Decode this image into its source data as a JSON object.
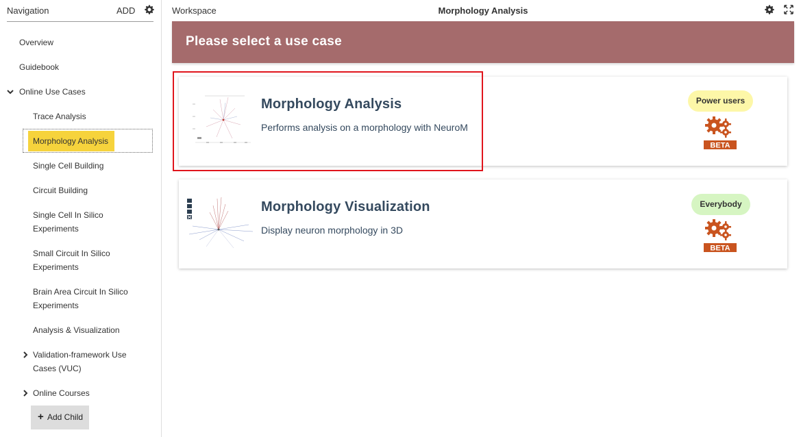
{
  "sidebar": {
    "title": "Navigation",
    "add_label": "ADD",
    "items": [
      {
        "label": "Overview"
      },
      {
        "label": "Guidebook"
      },
      {
        "label": "Online Use Cases"
      },
      {
        "label": "Trace Analysis"
      },
      {
        "label": "Morphology Analysis"
      },
      {
        "label": "Single Cell Building"
      },
      {
        "label": "Circuit Building"
      },
      {
        "label": "Single Cell In Silico",
        "label2": "Experiments"
      },
      {
        "label": "Small Circuit In Silico",
        "label2": "Experiments"
      },
      {
        "label": "Brain Area Circuit In Silico",
        "label2": "Experiments"
      },
      {
        "label": "Analysis & Visualization"
      },
      {
        "label": "Validation-framework Use",
        "label2": "Cases (VUC)"
      },
      {
        "label": "Online Courses"
      }
    ],
    "selected": "Morphology Analysis",
    "add_child_label": "Add Child"
  },
  "header": {
    "workspace_label": "Workspace",
    "page_title": "Morphology Analysis"
  },
  "banner": {
    "text": "Please select a use case"
  },
  "cards": [
    {
      "title": "Morphology Analysis",
      "description": "Performs analysis on a morphology with NeuroM",
      "badge": "Power users",
      "badge_color": "#fdf7a8",
      "tag": "BETA"
    },
    {
      "title": "Morphology Visualization",
      "description": "Display neuron morphology in 3D",
      "badge": "Everybody",
      "badge_color": "#d6f5c2",
      "tag": "BETA"
    }
  ],
  "colors": {
    "banner": "#a56b6c",
    "selected_highlight": "#f6d33c",
    "beta_orange": "#c9541f",
    "highlight_frame": "#e0151c"
  }
}
